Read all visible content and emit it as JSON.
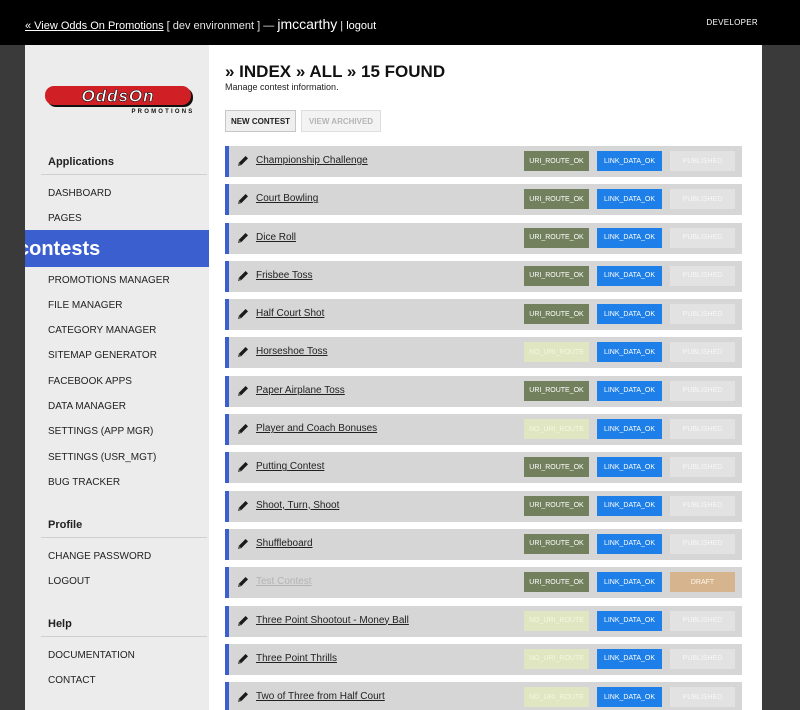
{
  "topbar": {
    "view_link": "« View Odds On Promotions",
    "env": "[ dev environment ] —",
    "user": "jmccarthy",
    "sep": "|",
    "logout": "logout",
    "role": "DEVELOPER"
  },
  "logo": {
    "word": "OddsOn",
    "tagline": "PROMOTIONS"
  },
  "sidebar": {
    "applications_heading": "Applications",
    "applications": [
      "DASHBOARD",
      "PAGES"
    ],
    "active": "contests",
    "applications_more": [
      "PROMOTIONS MANAGER",
      "FILE MANAGER",
      "CATEGORY MANAGER",
      "SITEMAP GENERATOR",
      "FACEBOOK APPS",
      "DATA MANAGER",
      "SETTINGS (APP MGR)",
      "SETTINGS (USR_MGT)",
      "BUG TRACKER"
    ],
    "profile_heading": "Profile",
    "profile": [
      "CHANGE PASSWORD",
      "LOGOUT"
    ],
    "help_heading": "Help",
    "help": [
      "DOCUMENTATION",
      "CONTACT"
    ]
  },
  "main": {
    "title": "» INDEX » ALL » 15 FOUND",
    "subtitle": "Manage contest information.",
    "new_button": "NEW CONTEST",
    "archived_button": "VIEW ARCHIVED"
  },
  "contests": [
    {
      "name": "Championship Challenge",
      "uri": "URI_ROUTE_OK",
      "link": "LINK_DATA_OK",
      "status": "PUBLISHED"
    },
    {
      "name": "Court Bowling",
      "uri": "URI_ROUTE_OK",
      "link": "LINK_DATA_OK",
      "status": "PUBLISHED"
    },
    {
      "name": "Dice Roll",
      "uri": "URI_ROUTE_OK",
      "link": "LINK_DATA_OK",
      "status": "PUBLISHED"
    },
    {
      "name": "Frisbee Toss",
      "uri": "URI_ROUTE_OK",
      "link": "LINK_DATA_OK",
      "status": "PUBLISHED"
    },
    {
      "name": "Half Court Shot",
      "uri": "URI_ROUTE_OK",
      "link": "LINK_DATA_OK",
      "status": "PUBLISHED"
    },
    {
      "name": "Horseshoe Toss",
      "uri": "NO_URI_ROUTE",
      "link": "LINK_DATA_OK",
      "status": "PUBLISHED"
    },
    {
      "name": "Paper Airplane Toss",
      "uri": "URI_ROUTE_OK",
      "link": "LINK_DATA_OK",
      "status": "PUBLISHED"
    },
    {
      "name": "Player and Coach Bonuses",
      "uri": "NO_URI_ROUTE",
      "link": "LINK_DATA_OK",
      "status": "PUBLISHED"
    },
    {
      "name": "Putting Contest",
      "uri": "URI_ROUTE_OK",
      "link": "LINK_DATA_OK",
      "status": "PUBLISHED"
    },
    {
      "name": "Shoot, Turn, Shoot",
      "uri": "URI_ROUTE_OK",
      "link": "LINK_DATA_OK",
      "status": "PUBLISHED"
    },
    {
      "name": "Shuffleboard",
      "uri": "URI_ROUTE_OK",
      "link": "LINK_DATA_OK",
      "status": "PUBLISHED"
    },
    {
      "name": "Test Contest",
      "uri": "URI_ROUTE_OK",
      "link": "LINK_DATA_OK",
      "status": "DRAFT"
    },
    {
      "name": "Three Point Shootout - Money Ball",
      "uri": "NO_URI_ROUTE",
      "link": "LINK_DATA_OK",
      "status": "PUBLISHED"
    },
    {
      "name": "Three Point Thrills",
      "uri": "NO_URI_ROUTE",
      "link": "LINK_DATA_OK",
      "status": "PUBLISHED"
    },
    {
      "name": "Two of Three from Half Court",
      "uri": "NO_URI_ROUTE",
      "link": "LINK_DATA_OK",
      "status": "PUBLISHED"
    }
  ],
  "colors": {
    "accent": "#3c5fcf",
    "uri_ok": "#73805e",
    "no_uri": "#dfe6c1",
    "link": "#1e7fe8",
    "published": "#e2e2e2",
    "draft": "#d6b58e",
    "logo_red": "#d11f26"
  }
}
